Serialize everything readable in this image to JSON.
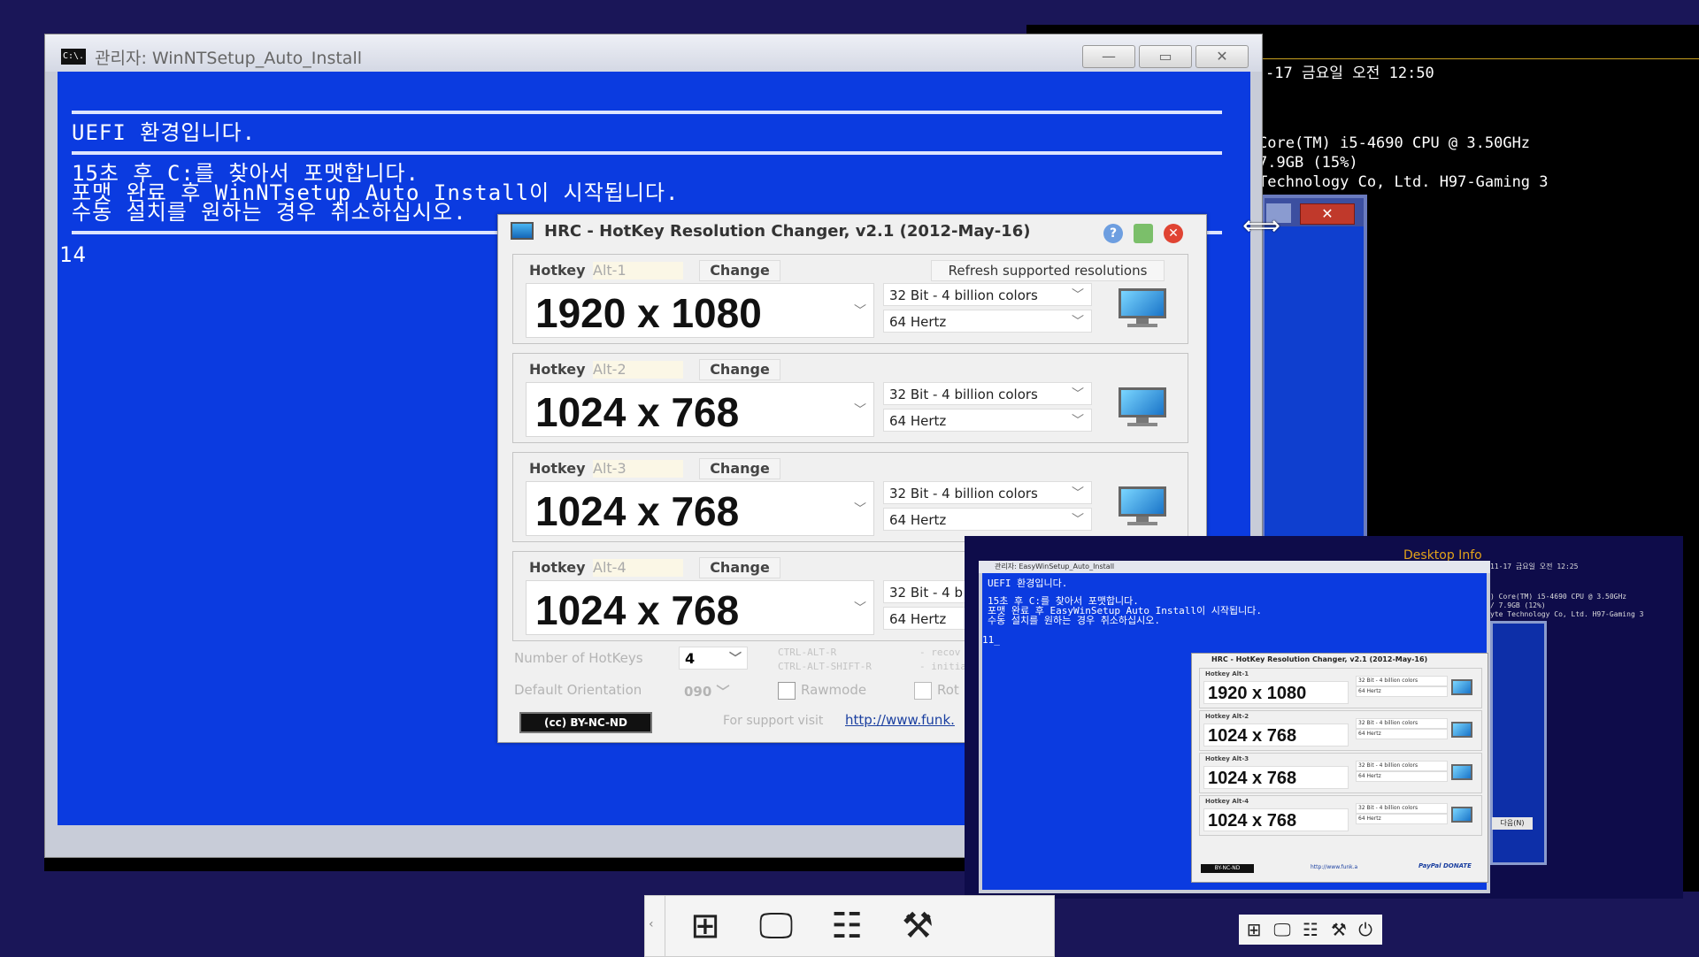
{
  "desktop_info": {
    "line1": "-17 금요일 오전 12:50",
    "line2": "Core(TM) i5-4690 CPU @ 3.50GHz",
    "line3": "7.9GB (15%)",
    "line4": " Technology Co, Ltd. H97-Gaming 3"
  },
  "back_window": {
    "close_label": "✕"
  },
  "console": {
    "title": "관리자:  WinNTSetup_Auto_Install",
    "icon_text": "C:\\.",
    "min_label": "—",
    "max_label": "▭",
    "close_label": "✕",
    "line_uefi": "UEFI 환경입니다.",
    "line_format": "15초 후 C:를 찾아서 포맷합니다.",
    "line_start": "포맷 완료 후 WinNTsetup Auto Install이 시작됩니다.",
    "line_cancel": "수동 설치를 원하는 경우 취소하십시오.",
    "countdown": "14"
  },
  "hrc": {
    "title": "HRC - HotKey Resolution Changer, v2.1 (2012-May-16)",
    "help_label": "?",
    "close_label": "✕",
    "refresh_label": "Refresh supported resolutions",
    "hotkey_word": "Hotkey",
    "change_label": "Change",
    "hotkeys": [
      {
        "key": "Alt-1",
        "resolution": "1920 x 1080",
        "color": "32 Bit - 4 billion colors",
        "freq": "64 Hertz"
      },
      {
        "key": "Alt-2",
        "resolution": "1024 x 768",
        "color": "32 Bit - 4 billion colors",
        "freq": "64 Hertz"
      },
      {
        "key": "Alt-3",
        "resolution": "1024 x 768",
        "color": "32 Bit - 4 billion colors",
        "freq": "64 Hertz"
      },
      {
        "key": "Alt-4",
        "resolution": "1024 x 768",
        "color": "32 Bit - 4 b",
        "freq": "64 Hertz"
      }
    ],
    "num_hotkeys_label": "Number of HotKeys",
    "num_hotkeys_value": "4",
    "default_orientation_label": "Default Orientation",
    "default_orientation_value": "090",
    "ctrl_alt_r": "CTRL-ALT-R",
    "ctrl_alt_shift_r": "CTRL-ALT-SHIFT-R",
    "recov": "- recov",
    "initial": "- initial",
    "rawmode_label": "Rawmode",
    "rot_label": "Rot",
    "license_label": "BY-NC-ND",
    "support_label": "For support visit",
    "support_link": "http://www.funk."
  },
  "preview": {
    "desktop_info_title": "Desktop Info",
    "cmd_title": "관리자: EasyWinSetup_Auto_Install",
    "line_uefi": "UEFI 환경입니다.",
    "line_format": "15초 후 C:를 찾아서 포맷합니다.",
    "line_start": "포맷 완료 후 EasyWinSetup Auto Install이 시작됩니다.",
    "line_cancel": "수동 설치를 원하는 경우 취소하십시오.",
    "countdown": "11_",
    "hrc_title": "HRC - HotKey Resolution Changer, v2.1 (2012-May-16)",
    "info1": "11-17 금요일 오전 12:25",
    "info2": ") Core(TM) i5-4690 CPU @ 3.50GHz",
    "info3": "/ 7.9GB (12%)",
    "info4": "yte Technology Co, Ltd. H97-Gaming 3",
    "next_label": "다음(N)",
    "rows": [
      {
        "label": "Hotkey Alt-1",
        "resolution": "1920 x 1080",
        "color": "32 Bit - 4 billion colors",
        "freq": "64 Hertz"
      },
      {
        "label": "Hotkey Alt-2",
        "resolution": "1024 x 768",
        "color": "32 Bit - 4 billion colors",
        "freq": "64 Hertz"
      },
      {
        "label": "Hotkey Alt-3",
        "resolution": "1024 x 768",
        "color": "32 Bit - 4 billion colors",
        "freq": "64 Hertz"
      },
      {
        "label": "Hotkey Alt-4",
        "resolution": "1024 x 768",
        "color": "32 Bit - 4 billion colors",
        "freq": "64 Hertz"
      }
    ],
    "paypal": "PayPal DONATE",
    "license": "BY-NC-ND",
    "support": "http://www.funk.a"
  },
  "colors": {
    "console_blue": "#0b3be0",
    "desktop_bg": "#1a1658",
    "desktop_info_accent": "#e2a21a"
  }
}
